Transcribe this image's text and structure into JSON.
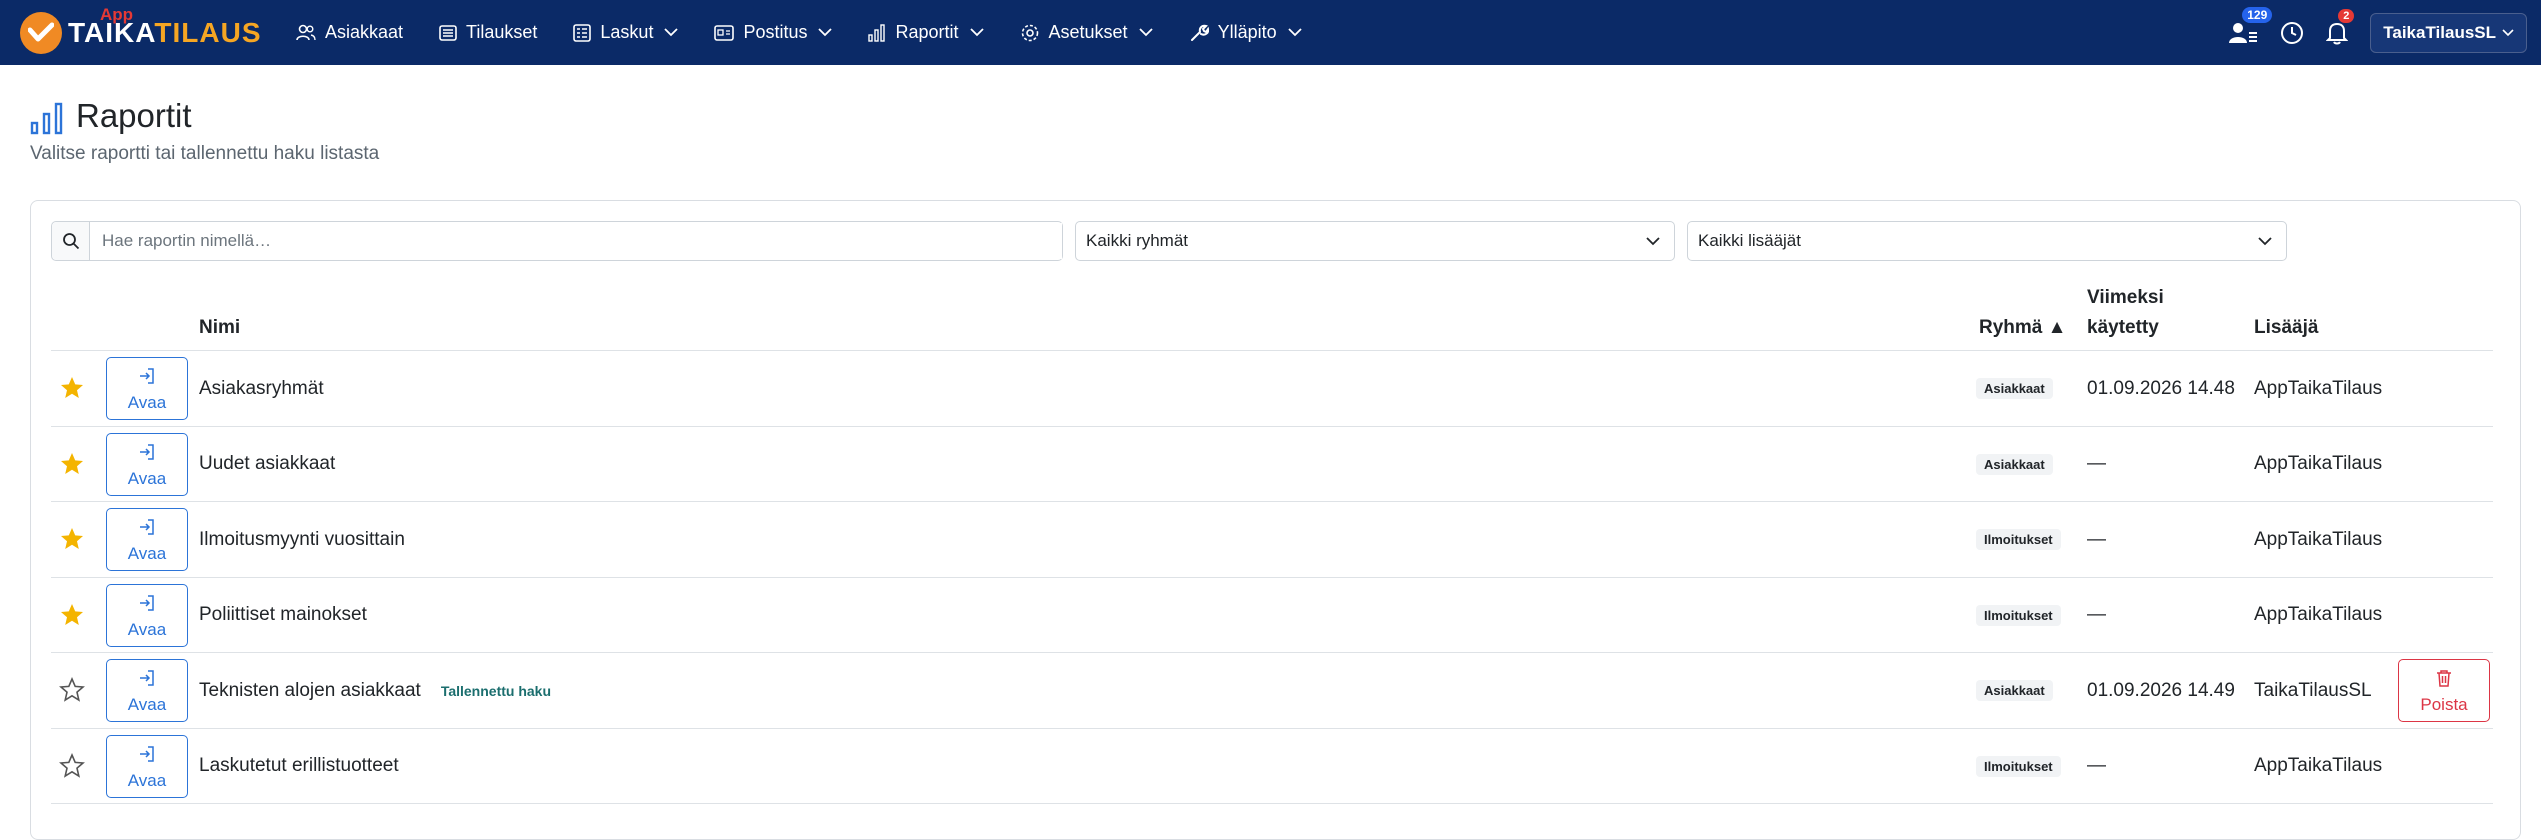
{
  "brand": {
    "app": "App",
    "taika": "TAIKA",
    "tilaus": "TILAUS"
  },
  "nav": [
    {
      "label": "Asiakkaat",
      "icon": "users-icon",
      "dropdown": false
    },
    {
      "label": "Tilaukset",
      "icon": "list-icon",
      "dropdown": false
    },
    {
      "label": "Laskut",
      "icon": "invoice-icon",
      "dropdown": true
    },
    {
      "label": "Postitus",
      "icon": "mail-icon",
      "dropdown": true
    },
    {
      "label": "Raportit",
      "icon": "chart-icon",
      "dropdown": true
    },
    {
      "label": "Asetukset",
      "icon": "gear-icon",
      "dropdown": true
    },
    {
      "label": "Ylläpito",
      "icon": "wrench-icon",
      "dropdown": true
    }
  ],
  "header_right": {
    "users_badge": "129",
    "notifications_badge": "2",
    "user_name": "TaikaTilausSL"
  },
  "page": {
    "title": "Raportit",
    "subtitle": "Valitse raportti tai tallennettu haku listasta"
  },
  "filters": {
    "search_placeholder": "Hae raportin nimellä…",
    "group_select": "Kaikki ryhmät",
    "adder_select": "Kaikki lisääjät"
  },
  "table": {
    "headers": {
      "name": "Nimi",
      "group": "Ryhmä ▲",
      "last_used_1": "Viimeksi",
      "last_used_2": "käytetty",
      "adder": "Lisääjä"
    },
    "open_label": "Avaa",
    "delete_label": "Poista",
    "rows": [
      {
        "favorite": true,
        "name": "Asiakasryhmät",
        "tag": "",
        "group": "Asiakkaat",
        "last_used": "01.09.2026 14.48",
        "adder": "AppTaikaTilaus",
        "deletable": false
      },
      {
        "favorite": true,
        "name": "Uudet asiakkaat",
        "tag": "",
        "group": "Asiakkaat",
        "last_used": "—",
        "adder": "AppTaikaTilaus",
        "deletable": false
      },
      {
        "favorite": true,
        "name": "Ilmoitusmyynti vuosittain",
        "tag": "",
        "group": "Ilmoitukset",
        "last_used": "—",
        "adder": "AppTaikaTilaus",
        "deletable": false
      },
      {
        "favorite": true,
        "name": "Poliittiset mainokset",
        "tag": "",
        "group": "Ilmoitukset",
        "last_used": "—",
        "adder": "AppTaikaTilaus",
        "deletable": false
      },
      {
        "favorite": false,
        "name": "Teknisten alojen asiakkaat",
        "tag": "Tallennettu haku",
        "group": "Asiakkaat",
        "last_used": "01.09.2026 14.49",
        "adder": "TaikaTilausSL",
        "deletable": true
      },
      {
        "favorite": false,
        "name": "Laskutetut erillistuotteet",
        "tag": "",
        "group": "Ilmoitukset",
        "last_used": "—",
        "adder": "AppTaikaTilaus",
        "deletable": false
      }
    ]
  },
  "colors": {
    "navbar": "#0b2a67",
    "brand_orange": "#f08a24",
    "primary": "#2c74d8",
    "danger": "#dc3545",
    "star": "#f4b400"
  }
}
